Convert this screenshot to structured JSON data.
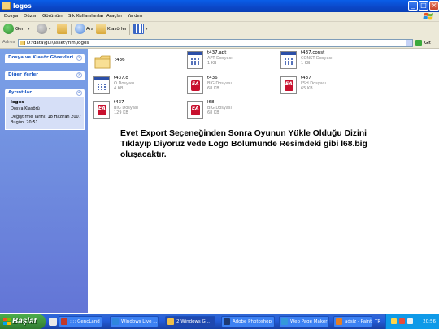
{
  "window": {
    "title": "logos"
  },
  "menu": {
    "items": [
      "Dosya",
      "Düzen",
      "Görünüm",
      "Sık Kullanılanlar",
      "Araçlar",
      "Yardım"
    ]
  },
  "toolbar": {
    "back_label": "Geri",
    "search_label": "Ara",
    "folders_label": "Klasörler"
  },
  "address": {
    "label": "Adres",
    "path": "D:\\data\\gui\\asset\\mm\\logos",
    "go_label": "Git"
  },
  "taskpane": {
    "file_tasks": "Dosya ve Klasör Görevleri",
    "other_places": "Diğer Yerler",
    "details": "Ayrıntılar",
    "details_title": "logos",
    "details_type": "Dosya Klasörü",
    "details_date": "Değiştirme Tarihi: 18 Haziran 2007 Bugün, 20:51"
  },
  "files": [
    {
      "name": "t436",
      "desc": "",
      "size": "",
      "icon": "folder-icon"
    },
    {
      "name": "t437.apt",
      "desc": "APT Dosyası",
      "size": "1 KB",
      "icon": "generic-file-icon"
    },
    {
      "name": "t437.const",
      "desc": "CONST Dosyası",
      "size": "1 KB",
      "icon": "generic-file-icon"
    },
    {
      "name": "t437.o",
      "desc": "O Dosyası",
      "size": "4 KB",
      "icon": "generic-file-icon"
    },
    {
      "name": "t436",
      "desc": "BIG Dosyası",
      "size": "68 KB",
      "icon": "ea-file-icon"
    },
    {
      "name": "t437",
      "desc": "FSH Dosyası",
      "size": "65 KB",
      "icon": "ea-file-icon"
    },
    {
      "name": "t437",
      "desc": "BIG Dosyası",
      "size": "129 KB",
      "icon": "ea-file-icon"
    },
    {
      "name": "l68",
      "desc": "BIG Dosyası",
      "size": "68 KB",
      "icon": "ea-file-icon"
    }
  ],
  "caption": "Evet Export Seçeneğinden Sonra Oyunun Yükle Olduğu Dizini Tıklayıp Diyoruz vede Logo Bölümünde Resimdeki gibi l68.big oluşacaktır.",
  "taskbar": {
    "start_label": "Başlat",
    "tasks": [
      {
        "label": ":::: GencLand :...",
        "color": "#c0392b"
      },
      {
        "label": "Windows Live ...",
        "color": "#2e86de"
      },
      {
        "label": "2 Windows G...",
        "color": "#f0c04a"
      },
      {
        "label": "Adobe Photoshop",
        "color": "#1f3b73"
      },
      {
        "label": "Web Page Maker",
        "color": "#3498db"
      },
      {
        "label": "adsiz - Paint",
        "color": "#e67e22"
      }
    ],
    "lang": "TR",
    "clock": "20:56"
  }
}
